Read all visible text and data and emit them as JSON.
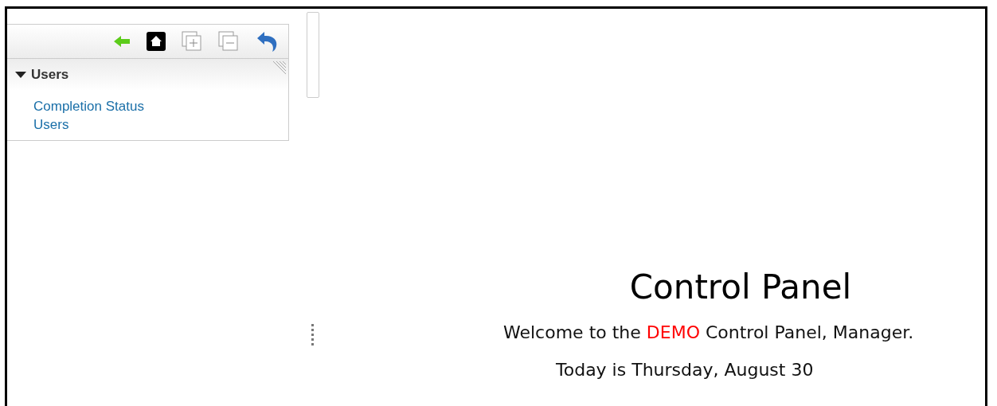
{
  "sidebar": {
    "section": {
      "title": "Users",
      "expanded": true,
      "links": [
        "Completion Status",
        "Users"
      ]
    }
  },
  "main": {
    "title": "Control Panel",
    "welcome": {
      "before": "Welcome to the ",
      "highlight": "DEMO",
      "after": " Control Panel, Manager."
    },
    "date": "Today is Thursday, August 30"
  }
}
